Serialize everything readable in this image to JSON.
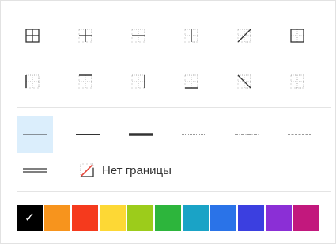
{
  "borders": {
    "row1": [
      {
        "icon": "all-borders-icon"
      },
      {
        "icon": "inner-borders-icon"
      },
      {
        "icon": "inner-horizontal-border-icon"
      },
      {
        "icon": "inner-vertical-border-icon"
      },
      {
        "icon": "diagonal-up-border-icon"
      },
      {
        "icon": "outer-borders-icon"
      }
    ],
    "row2": [
      {
        "icon": "left-border-icon"
      },
      {
        "icon": "top-border-icon"
      },
      {
        "icon": "right-border-icon"
      },
      {
        "icon": "bottom-border-icon"
      },
      {
        "icon": "diagonal-down-border-icon"
      },
      {
        "icon": "no-borders-grid-icon"
      }
    ]
  },
  "line_styles": [
    {
      "icon": "thin-line-icon",
      "selected": true
    },
    {
      "icon": "medium-line-icon",
      "selected": false
    },
    {
      "icon": "thick-line-icon",
      "selected": false
    },
    {
      "icon": "dotted-line-icon",
      "selected": false
    },
    {
      "icon": "dash-dot-line-icon",
      "selected": false
    },
    {
      "icon": "dashed-line-icon",
      "selected": false
    }
  ],
  "double_line": {
    "icon": "double-line-icon"
  },
  "no_border": {
    "icon": "no-border-icon",
    "label": "Нет границы"
  },
  "colors": {
    "selected_index": 0,
    "swatches": [
      "#000000",
      "#f7941d",
      "#f53a1d",
      "#fdd835",
      "#9ccc1b",
      "#2db53c",
      "#1aa3c6",
      "#2a73e8",
      "#3b3fe0",
      "#8b2fd6",
      "#c2187d"
    ]
  },
  "accent": "#dbeefc"
}
